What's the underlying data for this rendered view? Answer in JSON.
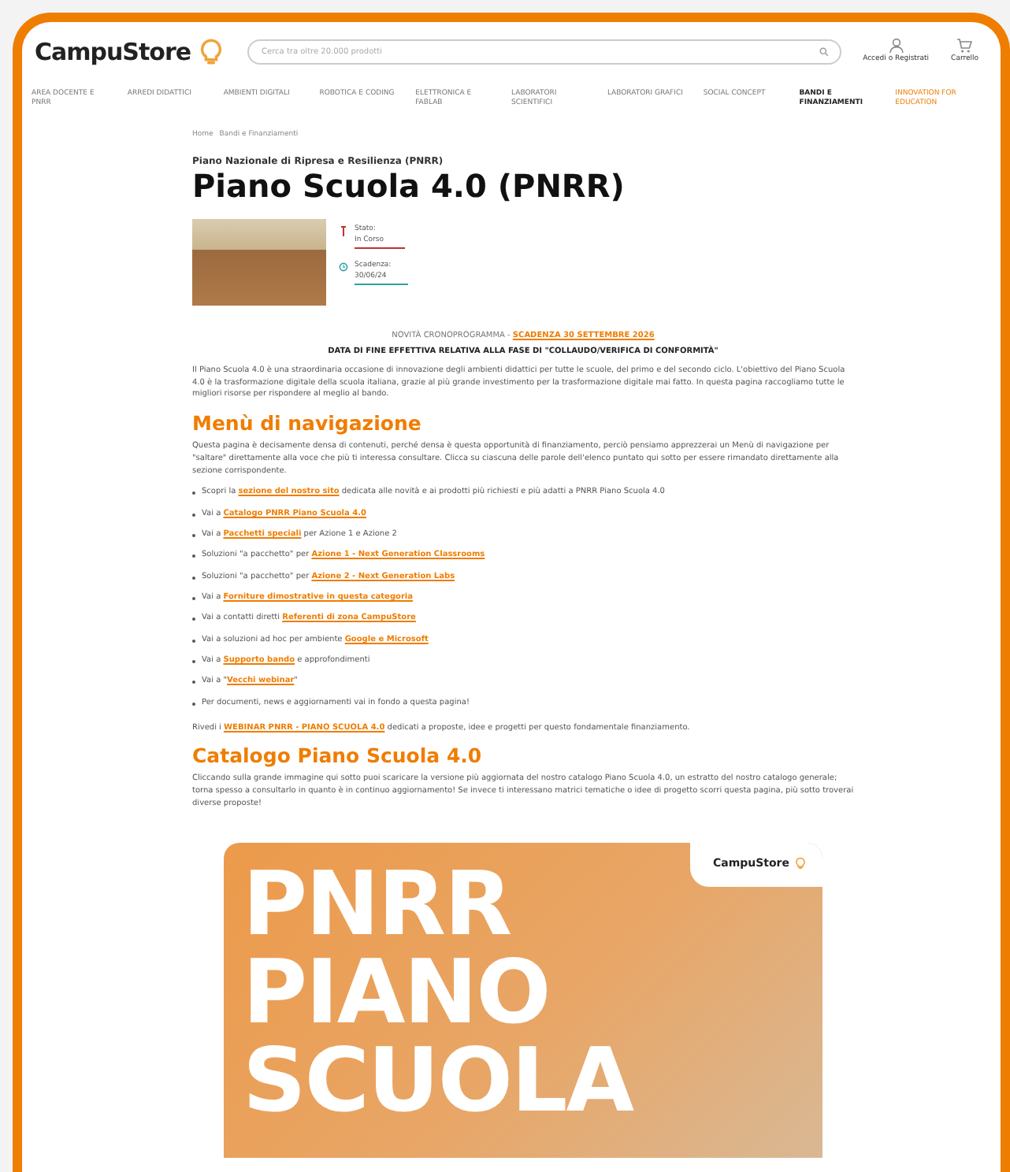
{
  "header": {
    "logo": "CampuStore",
    "search": {
      "placeholder": "Cerca tra oltre 20.000 prodotti"
    },
    "account": "Accedi o Registrati",
    "cart": "Carrello"
  },
  "nav": [
    {
      "label": "AREA DOCENTE E PNRR",
      "selected": false,
      "kind": "normal"
    },
    {
      "label": "ARREDI DIDATTICI",
      "selected": false,
      "kind": "normal"
    },
    {
      "label": "AMBIENTI DIGITALI",
      "selected": false,
      "kind": "normal"
    },
    {
      "label": "ROBOTICA E CODING",
      "selected": false,
      "kind": "normal"
    },
    {
      "label": "ELETTRONICA E FABLAB",
      "selected": false,
      "kind": "normal"
    },
    {
      "label": "LABORATORI SCIENTIFICI",
      "selected": false,
      "kind": "normal"
    },
    {
      "label": "LABORATORI GRAFICI",
      "selected": false,
      "kind": "normal"
    },
    {
      "label": "SOCIAL CONCEPT",
      "selected": false,
      "kind": "normal"
    },
    {
      "label": "BANDI E FINANZIAMENTI",
      "selected": true,
      "kind": "normal"
    },
    {
      "label": "INNOVATION FOR EDUCATION",
      "selected": false,
      "kind": "promo"
    }
  ],
  "breadcrumb": [
    "Home",
    "Bandi e Finanziamenti"
  ],
  "subtitle": "Piano Nazionale di Ripresa e Resilienza (PNRR)",
  "title": "Piano Scuola 4.0 (PNRR)",
  "status": {
    "label": "Stato:",
    "value": "In Corso"
  },
  "deadline": {
    "label": "Scadenza:",
    "value": "30/06/24"
  },
  "notice": {
    "text": "NOVITÀ CRONOPROGRAMMA - ",
    "link": "SCADENZA 30 SETTEMBRE 2026"
  },
  "notice_detail": "DATA DI FINE EFFETTIVA RELATIVA ALLA FASE DI \"COLLAUDO/VERIFICA DI CONFORMITÀ\"",
  "intro": "Il Piano Scuola 4.0 è una straordinaria occasione di innovazione degli ambienti didattici per tutte le scuole, del primo e del secondo ciclo. L'obiettivo del Piano Scuola 4.0 è la trasformazione digitale della scuola italiana, grazie al più grande investimento per la trasformazione digitale mai fatto. In questa pagina raccogliamo tutte le migliori risorse per rispondere al meglio al bando.",
  "menu_heading": "Menù di navigazione",
  "menu_intro": "Questa pagina è decisamente densa di contenuti, perché densa è questa opportunità di finanziamento, perciò pensiamo apprezzerai un Menù di navigazione per \"saltare\" direttamente alla voce che più ti interessa consultare. Clicca su ciascuna delle parole dell'elenco puntato qui sotto per essere rimandato direttamente alla sezione corrispondente.",
  "menu_items": [
    {
      "before": "Scopri la ",
      "link": "sezione del nostro sito",
      "after": " dedicata alle novità e ai prodotti più richiesti e più adatti a PNRR Piano Scuola 4.0"
    },
    {
      "before": "Vai a ",
      "link": "Catalogo PNRR Piano Scuola 4.0"
    },
    {
      "before": "Vai a ",
      "link": "Pacchetti speciali",
      "after": " per Azione 1 e Azione 2"
    },
    {
      "before": "Soluzioni \"a pacchetto\" per ",
      "link": "Azione 1 - Next Generation Classrooms"
    },
    {
      "before": "Soluzioni \"a pacchetto\" per ",
      "link": "Azione 2 - Next Generation Labs"
    },
    {
      "before": "Vai a ",
      "link": "Forniture dimostrative in questa categoria"
    },
    {
      "before": "Vai a contatti diretti ",
      "link": "Referenti di zona CampuStore"
    },
    {
      "before": "Vai a soluzioni ad hoc per ambiente ",
      "link": "Google e Microsoft"
    },
    {
      "before": "Vai a ",
      "link": "Supporto bando",
      "after": " e approfondimenti"
    },
    {
      "before": "Vai a \"",
      "link": "Vecchi webinar",
      "after": "\""
    },
    {
      "before": "Per documenti, news e aggiornamenti vai in fondo a questa pagina!"
    }
  ],
  "webinar": {
    "before": "Rivedi i ",
    "link": "WEBINAR PNRR - PIANO SCUOLA 4.0",
    "after": " dedicati a proposte, idee e progetti per questo fondamentale finanziamento."
  },
  "catalog_heading": "Catalogo Piano Scuola 4.0",
  "catalog_text": "Cliccando sulla grande immagine qui sotto puoi scaricare la versione più aggiornata del nostro catalogo Piano Scuola 4.0, un estratto del nostro catalogo generale; torna spesso a consultarlo in quanto è in continuo aggiornamento! Se invece ti interessano matrici tematiche o idee di progetto scorri questa pagina, più sotto troverai diverse proposte!",
  "banner": {
    "lines": [
      "PNRR",
      "PIANO",
      "SCUOLA"
    ],
    "logo": "CampuStore"
  }
}
